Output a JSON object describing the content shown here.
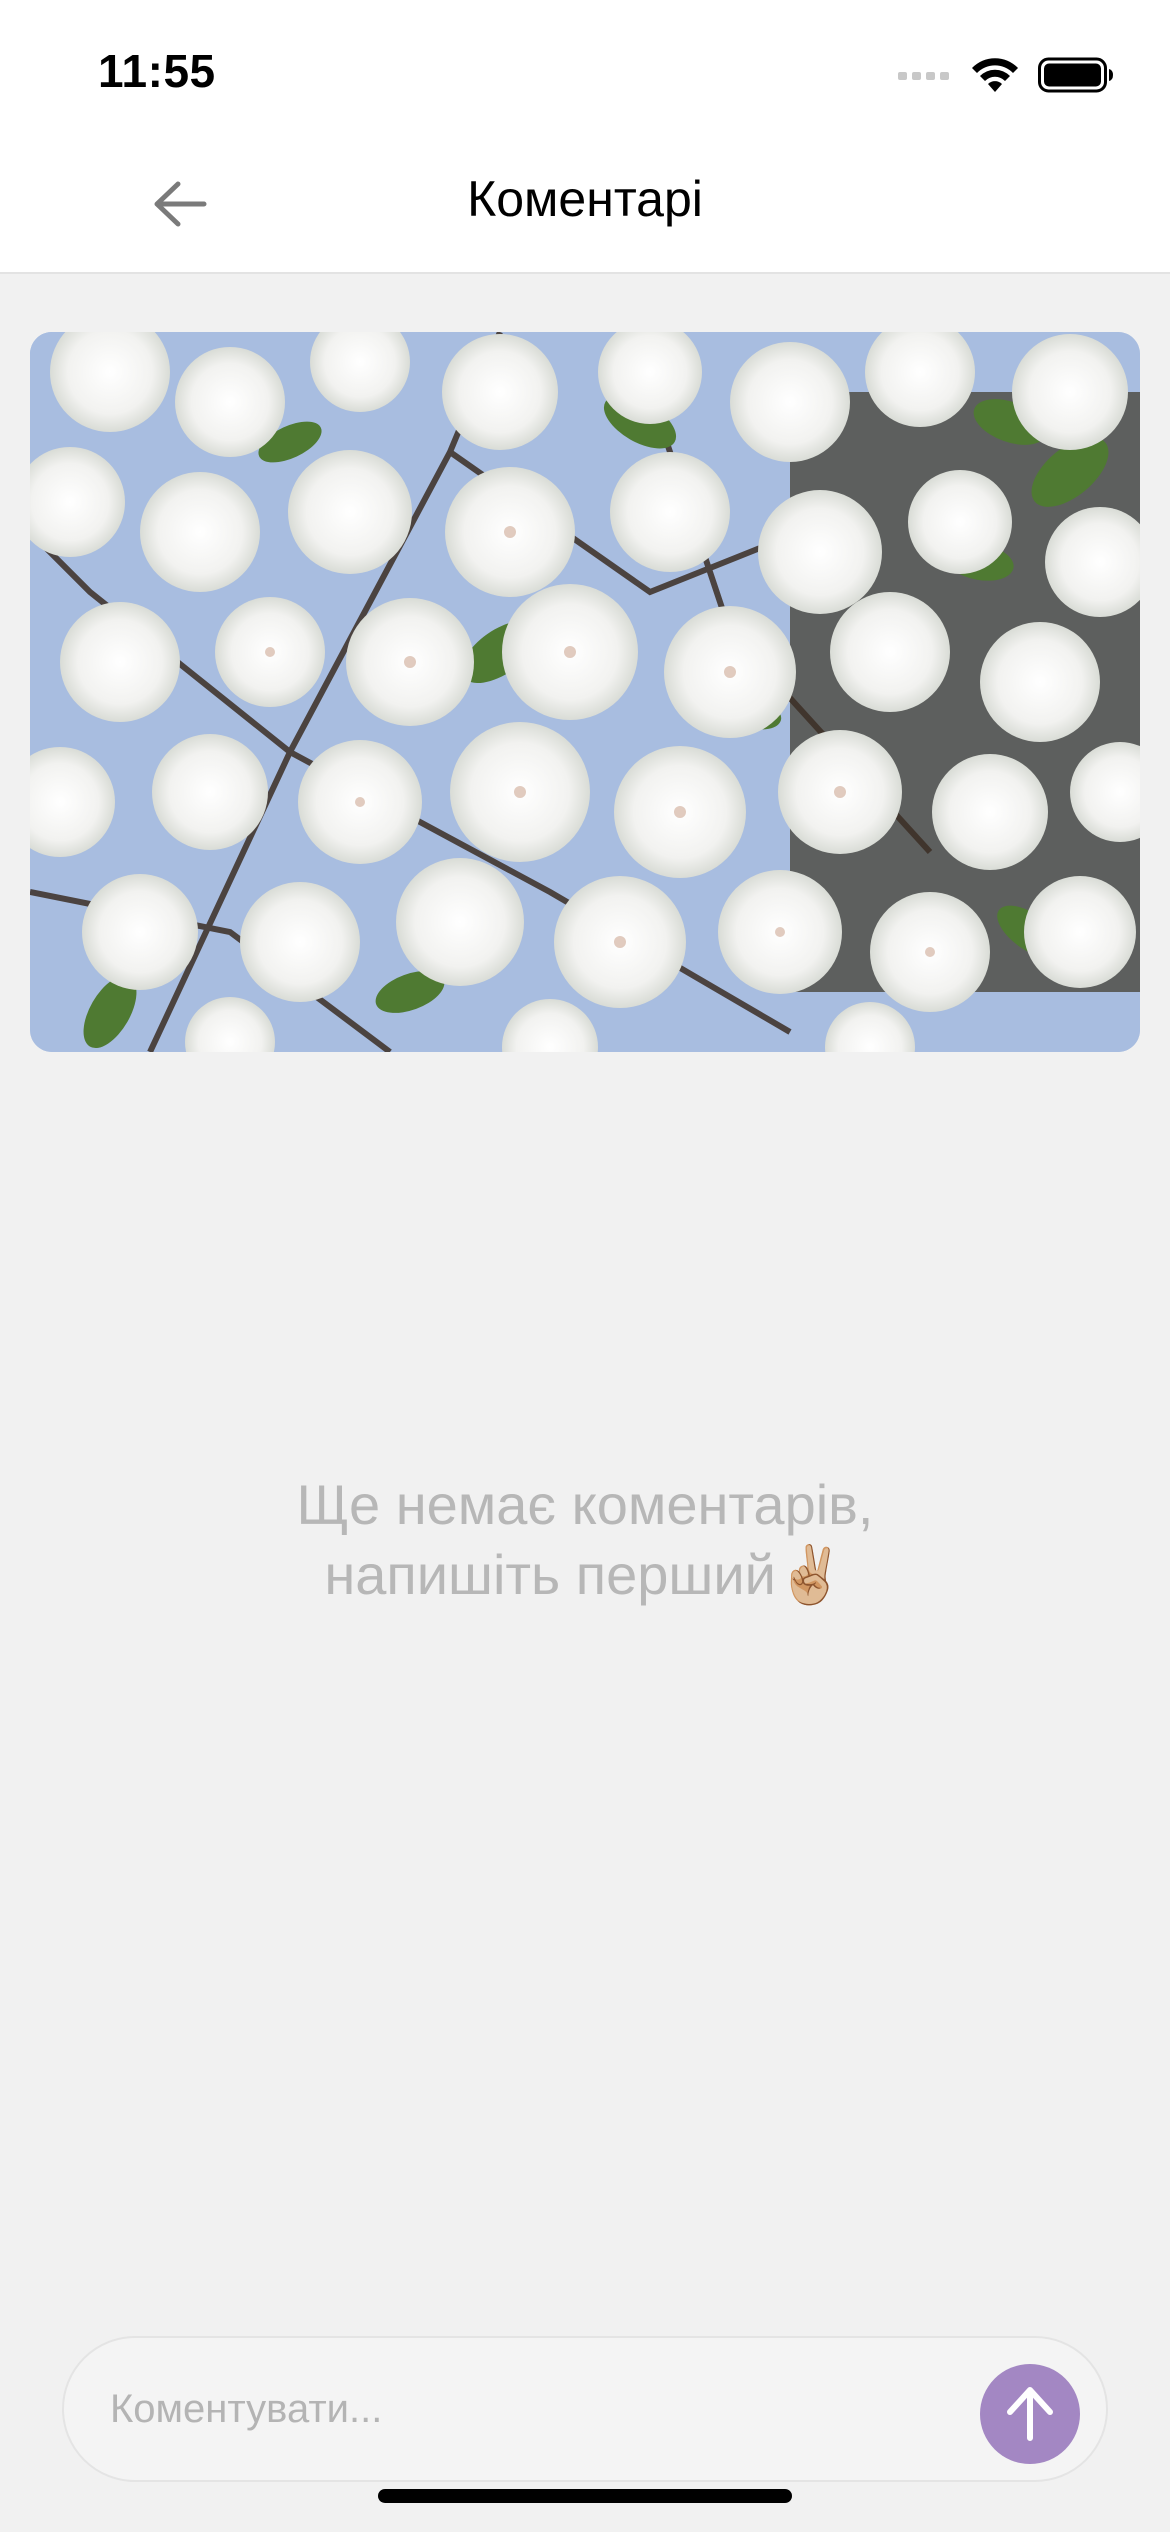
{
  "status_bar": {
    "time": "11:55",
    "icons": [
      "cellular-signal-icon",
      "wifi-icon",
      "battery-icon"
    ]
  },
  "header": {
    "title": "Коментарі",
    "back_icon": "arrow-left-icon"
  },
  "post": {
    "image_alt": "white cherry blossoms against a blue sky"
  },
  "empty_state": {
    "line1": "Ще немає коментарів,",
    "line2": "напишіть перший✌🏼"
  },
  "composer": {
    "placeholder": "Коментувати...",
    "value": "",
    "send_icon": "arrow-up-icon"
  },
  "colors": {
    "accent": "#a387c3",
    "background": "#f1f1f1",
    "muted_text": "#b7b7b7"
  }
}
